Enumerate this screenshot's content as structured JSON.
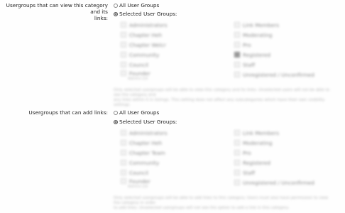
{
  "view_section": {
    "label_line1": "Usergroups that can view this category and its",
    "label_line2": "links:",
    "all_option": "All User Groups",
    "selected_option": "Selected User Groups:",
    "col_left": [
      "Administrators",
      "Chapter Heh",
      "Chapter Welcr",
      "Community",
      "Council",
      "Founder"
    ],
    "col_left_sub": "Admins Ltd",
    "col_right": [
      "Link Members",
      "Moderating",
      "Pro",
      "Registered",
      "Staff",
      "Unregistered / Unconfirmed"
    ],
    "note_lines": [
      "Only selected usergroups will be able to view this category and its links. Unselected users will not be able to see the category and",
      "any links within it in listings. This setting does not affect any subcategories which have their own visibility settings."
    ]
  },
  "add_section": {
    "label": "Usergroups that can add links:",
    "all_option": "All User Groups",
    "selected_option": "Selected User Groups:",
    "col_left": [
      "Administrators",
      "Chapter Heh",
      "Chapter Team",
      "Community",
      "Council",
      "Founder"
    ],
    "col_left_sub": "Admins Ltd",
    "col_right": [
      "Link Members",
      "Moderating",
      "Pro",
      "Registered",
      "Staff",
      "Unregistered / Unconfirmed"
    ],
    "note_lines": [
      "Only selected usergroups will be able to add links to this category. Users must also have permission to view the category in order",
      "to add links. Unselected usergroups will not see the option to add a link in this category."
    ]
  }
}
